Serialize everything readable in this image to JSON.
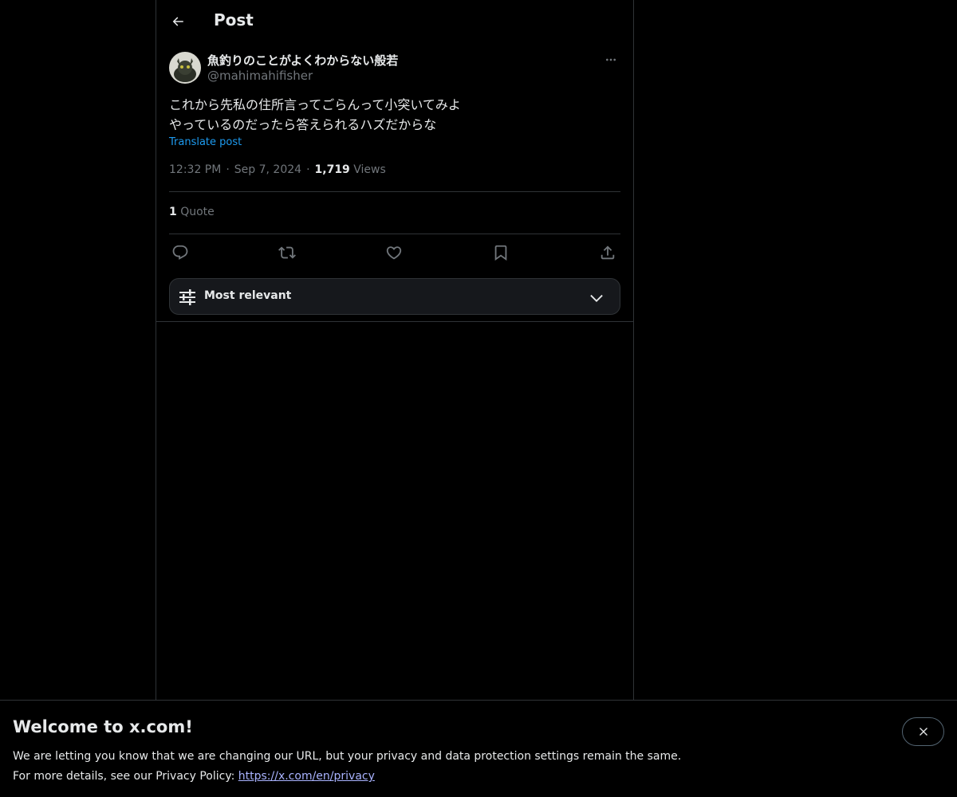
{
  "header": {
    "back_icon": "arrow-left-icon",
    "title": "Post"
  },
  "author": {
    "display_name": "魚釣りのことがよくわからない般若",
    "handle": "@mahimahifisher",
    "more_icon": "ellipsis-icon"
  },
  "post": {
    "text_line1": "これから先私の住所言ってごらんって小突いてみよ",
    "text_line2": "やっているのだったら答えられるハズだからな",
    "translate_label": "Translate post",
    "time": "12:32 PM",
    "date": "Sep 7, 2024",
    "views_count": "1,719",
    "views_label": "Views",
    "quote_count": "1",
    "quote_label": "Quote"
  },
  "actions": [
    {
      "name": "reply",
      "icon": "reply-icon"
    },
    {
      "name": "repost",
      "icon": "repost-icon"
    },
    {
      "name": "like",
      "icon": "heart-icon"
    },
    {
      "name": "bookmark",
      "icon": "bookmark-icon"
    },
    {
      "name": "share",
      "icon": "share-icon"
    }
  ],
  "sort": {
    "label": "Most relevant",
    "icon": "sliders-icon",
    "chevron": "chevron-down-icon"
  },
  "banner": {
    "title": "Welcome to x.com!",
    "line1": "We are letting you know that we are changing our URL, but your privacy and data protection settings remain the same.",
    "line2_prefix": "For more details, see our Privacy Policy: ",
    "link_text": "https://x.com/en/privacy",
    "close_icon": "close-icon"
  },
  "colors": {
    "background": "#000000",
    "text": "#e7e9ea",
    "muted": "#71767b",
    "accent": "#1d9bf0",
    "border": "#2f3336"
  }
}
